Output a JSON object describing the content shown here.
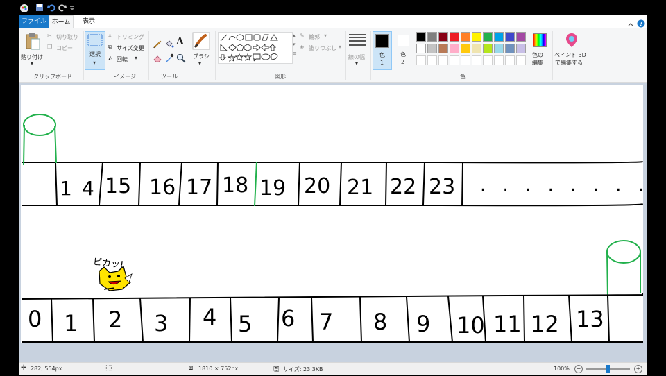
{
  "tabs": {
    "file": "ファイル",
    "home": "ホーム",
    "view": "表示"
  },
  "clipboard": {
    "paste": "貼り付け",
    "cut": "切り取り",
    "copy": "コピー",
    "group": "クリップボード"
  },
  "image": {
    "select": "選択",
    "crop": "トリミング",
    "resize": "サイズ変更",
    "rotate": "回転",
    "group": "イメージ"
  },
  "tools": {
    "group": "ツール",
    "text_glyph": "A"
  },
  "brush": {
    "label": "ブラシ"
  },
  "shapes": {
    "outline": "輪郭",
    "fill": "塗りつぶし",
    "group": "図形"
  },
  "size": {
    "label": "線の幅"
  },
  "colors": {
    "color1": "色",
    "color1_num": "1",
    "color2": "色",
    "color2_num": "2",
    "edit": "色の\n編集",
    "edit_line1": "色の",
    "edit_line2": "編集",
    "group": "色",
    "color1_value": "#000000",
    "color2_value": "#ffffff",
    "palette_row1": [
      "#000000",
      "#7f7f7f",
      "#880015",
      "#ed1c24",
      "#ff7f27",
      "#fff200",
      "#22b14c",
      "#00a2e8",
      "#3f48cc",
      "#a349a4"
    ],
    "palette_row2": [
      "#ffffff",
      "#c3c3c3",
      "#b97a57",
      "#ffaec9",
      "#ffc90e",
      "#efe4b0",
      "#b5e61d",
      "#99d9ea",
      "#7092be",
      "#c8bfe7"
    ]
  },
  "paint3d": {
    "line1": "ペイント 3D",
    "line2": "で編集する"
  },
  "drawing": {
    "top_numbers": [
      "1",
      "4",
      "15",
      "16",
      "17",
      "18",
      "19",
      "20",
      "21",
      "22",
      "23"
    ],
    "top_dots": ". . . . . . . .",
    "bottom_numbers": [
      "0",
      "1",
      "2",
      "3",
      "4",
      "5",
      "6",
      "7",
      "8",
      "9",
      "10",
      "11",
      "12",
      "13"
    ],
    "speech": "ピカッ!",
    "line_color": "#000000",
    "pipe_color": "#22b14c",
    "character_color": "#ffe400"
  },
  "status": {
    "cursor": "282, 554px",
    "dimensions": "1810 × 752px",
    "filesize": "サイズ: 23.3KB",
    "zoom": "100%",
    "zoom_level": 100
  }
}
